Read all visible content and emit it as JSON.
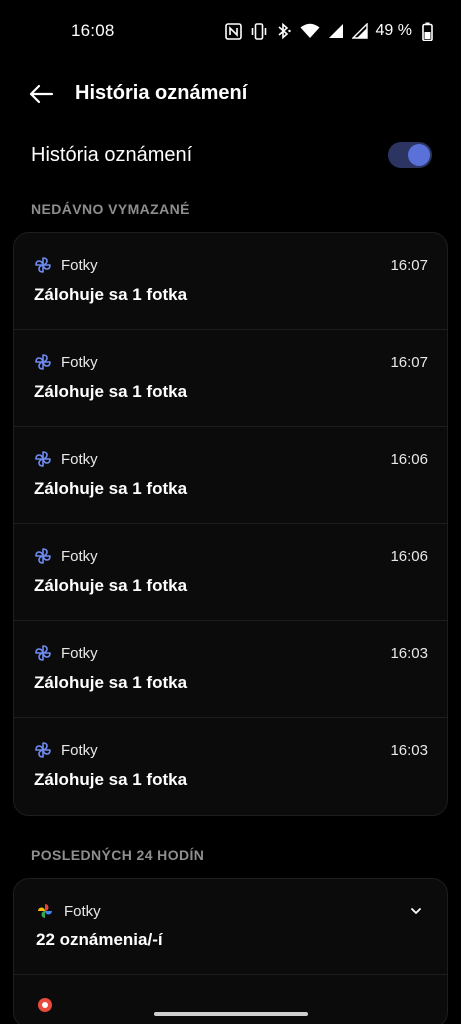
{
  "status_bar": {
    "time": "16:08",
    "battery": "49 %",
    "icons": [
      "nfc-icon",
      "vibrate-icon",
      "bluetooth-icon",
      "wifi-icon",
      "signal-icon",
      "signal-icon",
      "battery-icon"
    ]
  },
  "app_bar": {
    "back_icon": "arrow-left-icon",
    "title": "História oznámení"
  },
  "toggle": {
    "label": "História oznámení",
    "enabled": true,
    "accent_color": "#5a71d9"
  },
  "recently_dismissed": {
    "header": "NEDÁVNO VYMAZANÉ",
    "items": [
      {
        "app": "Fotky",
        "time": "16:07",
        "text": "Zálohuje sa 1 fotka",
        "icon": "pinwheel-icon"
      },
      {
        "app": "Fotky",
        "time": "16:07",
        "text": "Zálohuje sa 1 fotka",
        "icon": "pinwheel-icon"
      },
      {
        "app": "Fotky",
        "time": "16:06",
        "text": "Zálohuje sa 1 fotka",
        "icon": "pinwheel-icon"
      },
      {
        "app": "Fotky",
        "time": "16:06",
        "text": "Zálohuje sa 1 fotka",
        "icon": "pinwheel-icon"
      },
      {
        "app": "Fotky",
        "time": "16:03",
        "text": "Zálohuje sa 1 fotka",
        "icon": "pinwheel-icon"
      },
      {
        "app": "Fotky",
        "time": "16:03",
        "text": "Zálohuje sa 1 fotka",
        "icon": "pinwheel-icon"
      }
    ]
  },
  "last_24h": {
    "header": "POSLEDNÝCH 24 HODÍN",
    "groups": [
      {
        "app": "Fotky",
        "count": "22 oznámenia/-í",
        "icon": "google-photos-icon",
        "chevron": "chevron-down-icon"
      }
    ]
  }
}
